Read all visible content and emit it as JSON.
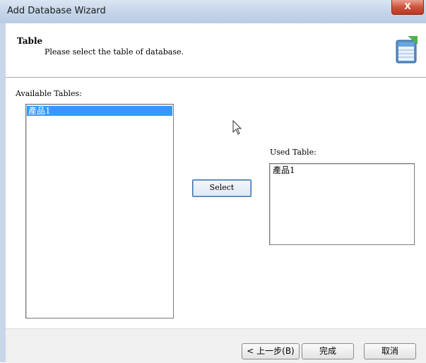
{
  "window": {
    "title": "Add Database Wizard",
    "close_label": "X"
  },
  "header": {
    "title": "Table",
    "subtitle": "Please select the table of database."
  },
  "available": {
    "label": "Available Tables:",
    "items": [
      "產品1"
    ],
    "selected_index": 0
  },
  "used": {
    "label": "Used Table:",
    "items": [
      "產品1"
    ]
  },
  "select_button": {
    "label": "Select"
  },
  "footer": {
    "back_label": "< 上一步(B)",
    "finish_label": "完成",
    "cancel_label": "取消"
  }
}
